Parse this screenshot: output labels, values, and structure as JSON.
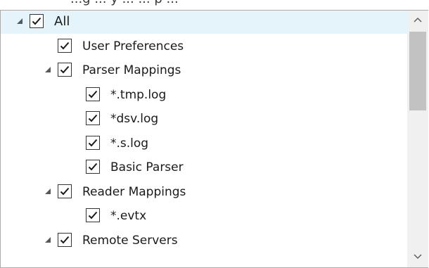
{
  "header": {
    "cutoff_text": "...g ... y ...  ... p ..."
  },
  "tree": {
    "items": [
      {
        "label": "All",
        "level": 0,
        "checked": true,
        "expander": true,
        "selected": true
      },
      {
        "label": "User Preferences",
        "level": 1,
        "checked": true,
        "expander": false,
        "selected": false
      },
      {
        "label": "Parser Mappings",
        "level": 1,
        "checked": true,
        "expander": true,
        "selected": false
      },
      {
        "label": "*.tmp.log",
        "level": 2,
        "checked": true,
        "expander": false,
        "selected": false
      },
      {
        "label": "*dsv.log",
        "level": 2,
        "checked": true,
        "expander": false,
        "selected": false
      },
      {
        "label": "*.s.log",
        "level": 2,
        "checked": true,
        "expander": false,
        "selected": false
      },
      {
        "label": "Basic Parser",
        "level": 2,
        "checked": true,
        "expander": false,
        "selected": false
      },
      {
        "label": "Reader Mappings",
        "level": 1,
        "checked": true,
        "expander": true,
        "selected": false
      },
      {
        "label": "*.evtx",
        "level": 2,
        "checked": true,
        "expander": false,
        "selected": false
      },
      {
        "label": "Remote Servers",
        "level": 1,
        "checked": true,
        "expander": true,
        "selected": false
      }
    ]
  },
  "scrollbar": {
    "up_icon": "chevron-up-icon",
    "down_icon": "chevron-down-icon"
  },
  "colors": {
    "selected_row": "#e5f3fb",
    "scroll_thumb": "#c2c2c2",
    "scroll_track": "#f0f0f0"
  }
}
